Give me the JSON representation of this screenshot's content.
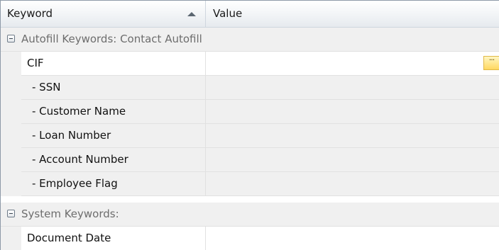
{
  "header": {
    "keyword_label": "Keyword",
    "value_label": "Value",
    "sort_icon": "sort-ascending-icon"
  },
  "groups": [
    {
      "label": "Autofill Keywords:  Contact Autofill",
      "rows": [
        {
          "keyword": "CIF",
          "value": ""
        },
        {
          "keyword": "- SSN",
          "value": ""
        },
        {
          "keyword": "- Customer Name",
          "value": ""
        },
        {
          "keyword": "- Loan Number",
          "value": ""
        },
        {
          "keyword": "- Account Number",
          "value": ""
        },
        {
          "keyword": "- Employee Flag",
          "value": ""
        }
      ]
    },
    {
      "label": "System Keywords:",
      "rows": [
        {
          "keyword": "Document Date",
          "value": ""
        }
      ]
    }
  ],
  "ellipsis_button": "···",
  "colors": {
    "group_background": "#f0f0f0",
    "group_text": "#6d6d6d",
    "ellipsis_button": "#ffd860",
    "grid_lines": "#e1e1e1"
  }
}
